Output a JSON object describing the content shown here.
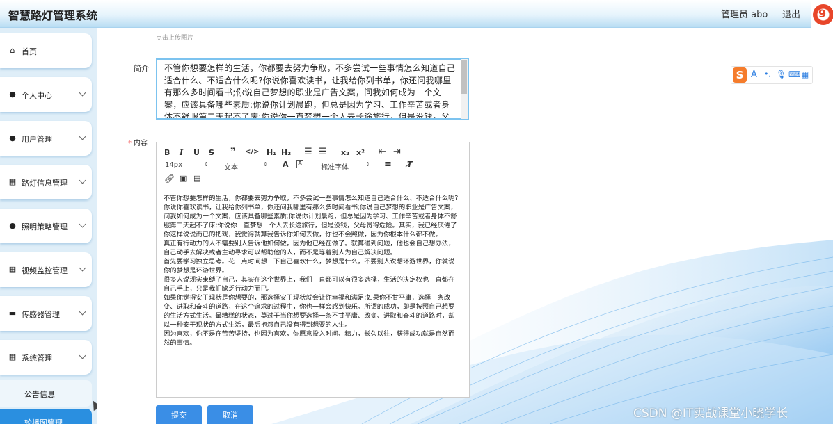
{
  "header": {
    "app_title": "智慧路灯管理系统",
    "admin_label": "管理员 abo",
    "logout_label": "退出"
  },
  "sidebar": {
    "items": [
      {
        "label": "首页",
        "icon": "home-icon",
        "expandable": false
      },
      {
        "label": "个人中心",
        "icon": "user-icon",
        "expandable": true
      },
      {
        "label": "用户管理",
        "icon": "pin-icon",
        "expandable": true
      },
      {
        "label": "路灯信息管理",
        "icon": "grid-icon",
        "expandable": true
      },
      {
        "label": "照明策略管理",
        "icon": "user-icon",
        "expandable": true
      },
      {
        "label": "视频监控管理",
        "icon": "grid-icon",
        "expandable": true
      },
      {
        "label": "传感器管理",
        "icon": "monitor-icon",
        "expandable": true
      },
      {
        "label": "系统管理",
        "icon": "grid-icon",
        "expandable": true
      }
    ],
    "sub_items": [
      {
        "label": "公告信息",
        "active": false
      },
      {
        "label": "轮播图管理",
        "active": true
      }
    ]
  },
  "form": {
    "upload_hint": "点击上传图片",
    "intro_label": "简介",
    "intro_value": "不管你想要怎样的生活，你都要去努力争取，不多尝试一些事情怎么知道自己适合什么、不适合什么呢?你说你喜欢读书，让我给你列书单，你还问我哪里有那么多时间看书;你说自己梦想的职业是广告文案，问我如何成为一个文案，应该具备哪些素质;你说你计划晨跑，但总是因为学习、工作辛苦或者身体不舒服第二天起不了床;你说你一直梦想一个人去长途旅行，但是没钱，父母觉得危险。",
    "content_label": "内容",
    "required_mark": "*",
    "toolbar": {
      "font_size": "14px",
      "text_type": "文本",
      "font_family": "标准字体"
    },
    "content_paragraphs": [
      "不管你想要怎样的生活，你都要去努力争取，不多尝试一些事情怎么知道自己适合什么、不适合什么呢?",
      "你说你喜欢读书，让我给你列书单，你还问我哪里有那么多时间看书;你说自己梦想的职业是广告文案，问我如何成为一个文案，应该具备哪些素质;你说你计划晨跑，但总是因为学习、工作辛苦或者身体不舒服第二天起不了床;你说你一直梦想一个人去长途旅行，但是没钱，父母觉得危险。其实，我已经厌倦了你这样说说而已的把戏，我觉得就算我告诉你如何去做，你也不会照做，因为你根本什么都不做。",
      "真正有行动力的人不需要别人告诉他如何做，因为他已经在做了。就算碰到问题，他也会自己想办法，自己动手去解决或者主动寻求可以帮助他的人，而不是等着别人为自己解决问题。",
      "首先要学习独立思考。花一点时间想一下自己喜欢什么，梦想是什么，不要别人说想环游世界，你就说你的梦想是环游世界。",
      "很多人说现实束缚了自己，其实在这个世界上，我们一直都可以有很多选择，生活的决定权也一直都在自己手上，只是我们缺乏行动力而已。",
      "如果你觉得安于现状是你想要的，那选择安于现状就会让你幸福和满足;如果你不甘平庸，选择一条改变、进取和奋斗的道路，在这个追求的过程中，你也一样会感到快乐。所谓的成功，即是按照自己想要的生活方式生活。最糟糕的状态，莫过于当你想要选择一条不甘平庸、改变、进取和奋斗的道路时，却以一种安于现状的方式生活，最后抱怨自己没有得到想要的人生。",
      "因为喜欢，你不是在苦苦坚持，也因为喜欢，你愿意投入时间、精力，长久以往，获得成功就是自然而然的事情。"
    ],
    "submit_label": "提交",
    "cancel_label": "取消"
  },
  "ime_toolbar": {
    "brand": "S",
    "mode": "A"
  },
  "watermark": "CSDN @IT实战课堂小晓学长",
  "colors": {
    "primary": "#3a8ee6",
    "active_menu": "#2a8fe0",
    "required": "#f56c6c",
    "sidebar_bg": "#dfeef8"
  }
}
